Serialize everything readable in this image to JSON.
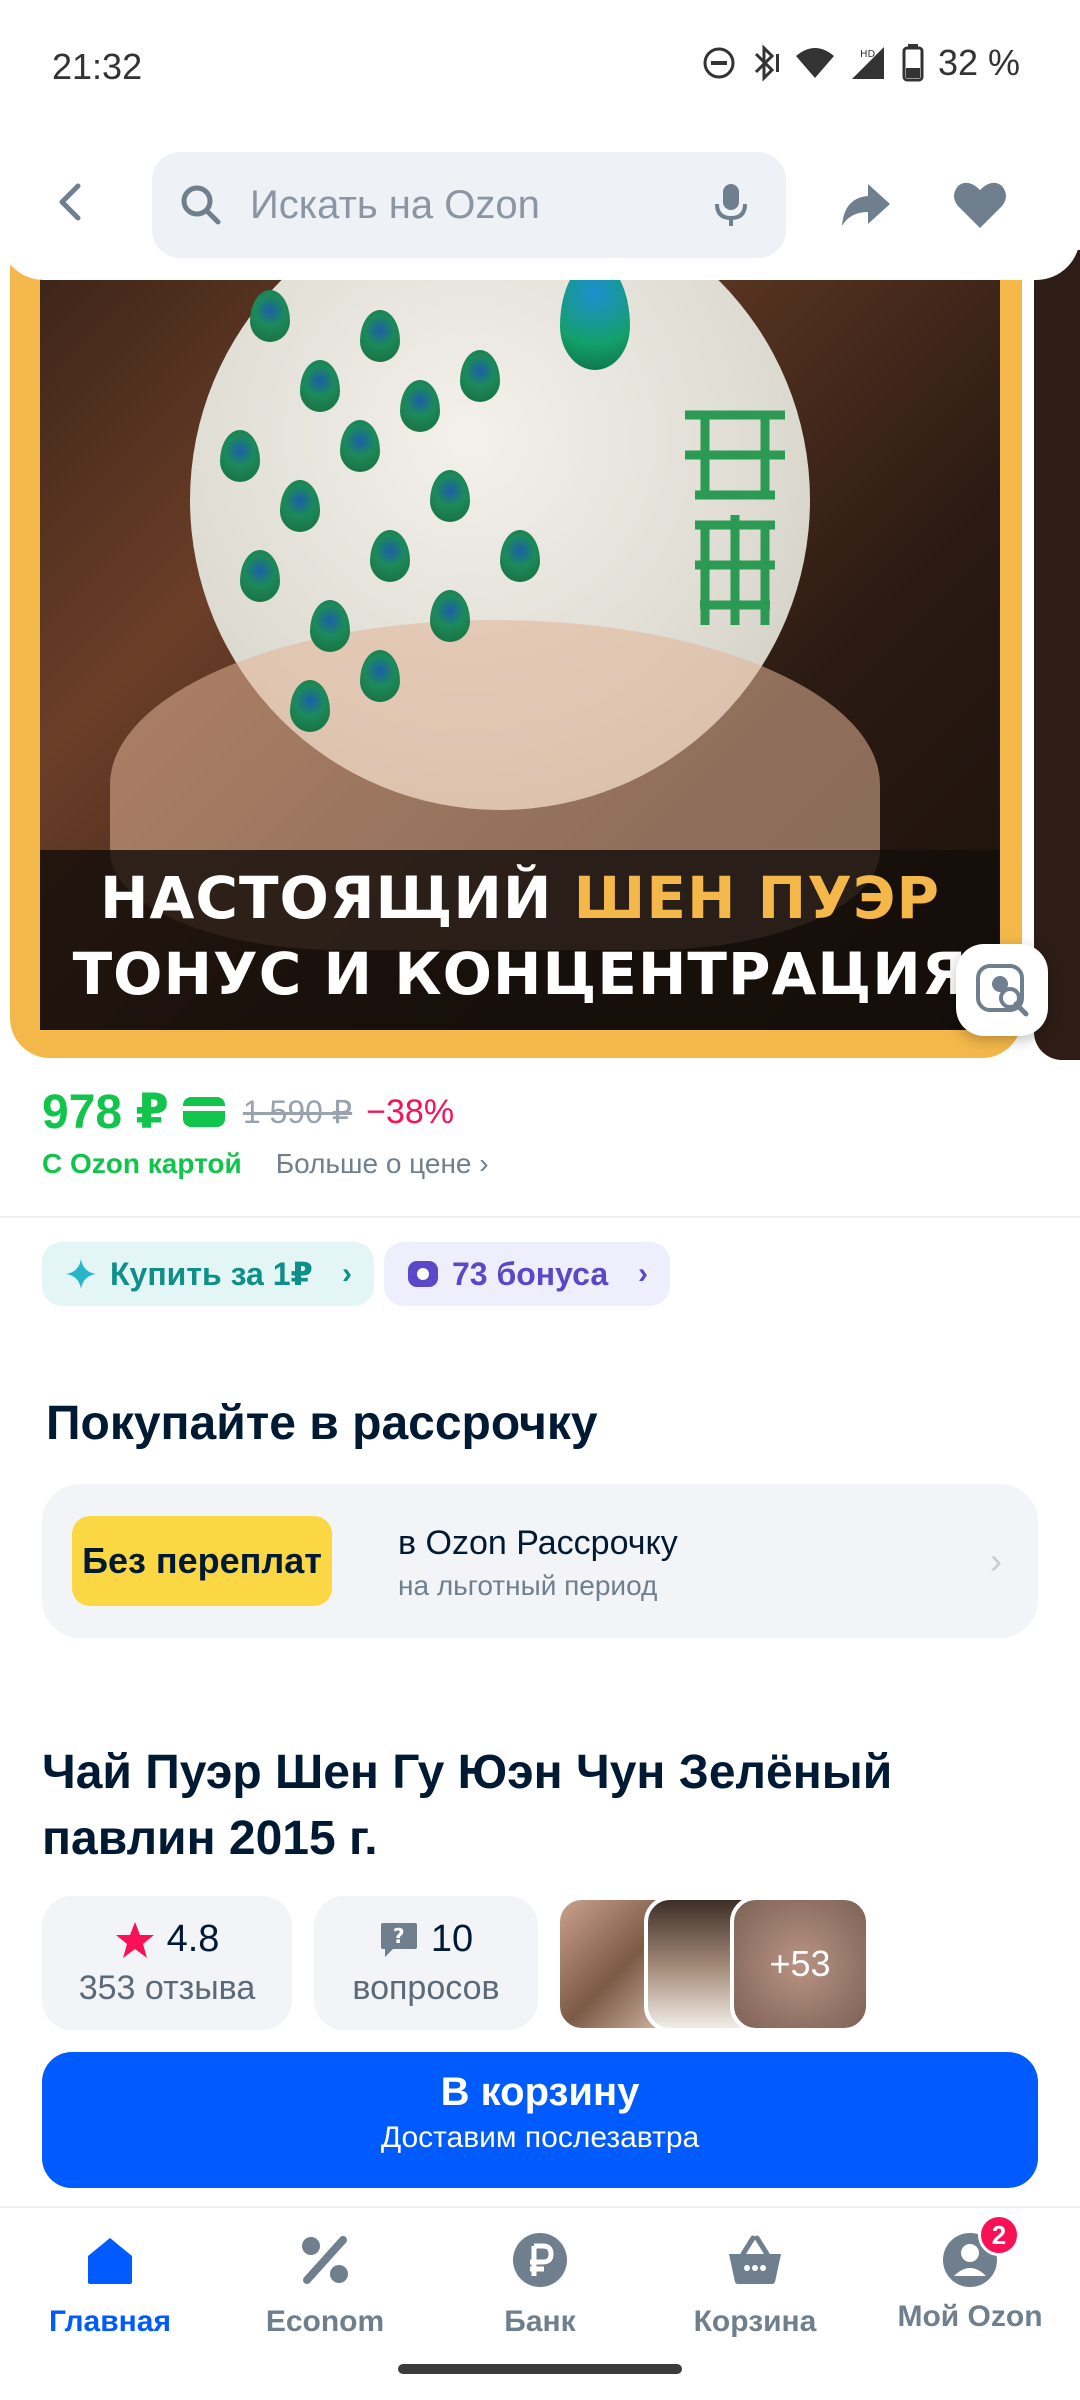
{
  "status_bar": {
    "time": "21:32",
    "battery": "32 %"
  },
  "header": {
    "search_placeholder": "Искать на Ozon"
  },
  "hero": {
    "caption_line1_a": "НАСТОЯЩИЙ ",
    "caption_line1_b": "ШЕН ПУЭР",
    "caption_line2": "ТОНУС И КОНЦЕНТРАЦИЯ"
  },
  "price": {
    "current": "978 ₽",
    "old": "1 590 ₽",
    "discount": "−38%",
    "ozon_card": "С Ozon картой",
    "more": "Больше о цене"
  },
  "chips": {
    "buy_for_one": "Купить за 1₽",
    "bonus": "73 бонуса"
  },
  "installment": {
    "heading": "Покупайте в рассрочку",
    "badge": "Без переплат",
    "line1": "в Ozon Рассрочку",
    "line2": "на льготный период"
  },
  "product": {
    "title": "Чай Пуэр Шен Гу Юэн Чун Зелёный павлин 2015 г.",
    "rating": "4.8",
    "reviews": "353 отзыва",
    "questions_count": "10",
    "questions_label": "вопросов",
    "more_photos": "+53"
  },
  "cart_button": {
    "label": "В корзину",
    "sub": "Доставим послезавтра"
  },
  "nav": {
    "items": [
      {
        "label": "Главная",
        "icon": "home-icon"
      },
      {
        "label": "Econom",
        "icon": "percent-icon"
      },
      {
        "label": "Банк",
        "icon": "ruble-icon"
      },
      {
        "label": "Корзина",
        "icon": "basket-icon"
      },
      {
        "label": "Мой Ozon",
        "icon": "profile-icon"
      }
    ],
    "profile_badge": "2"
  },
  "colors": {
    "accent": "#005bff",
    "price_green": "#10c44c",
    "discount_red": "#f91155",
    "installment_yellow": "#fbd843"
  }
}
